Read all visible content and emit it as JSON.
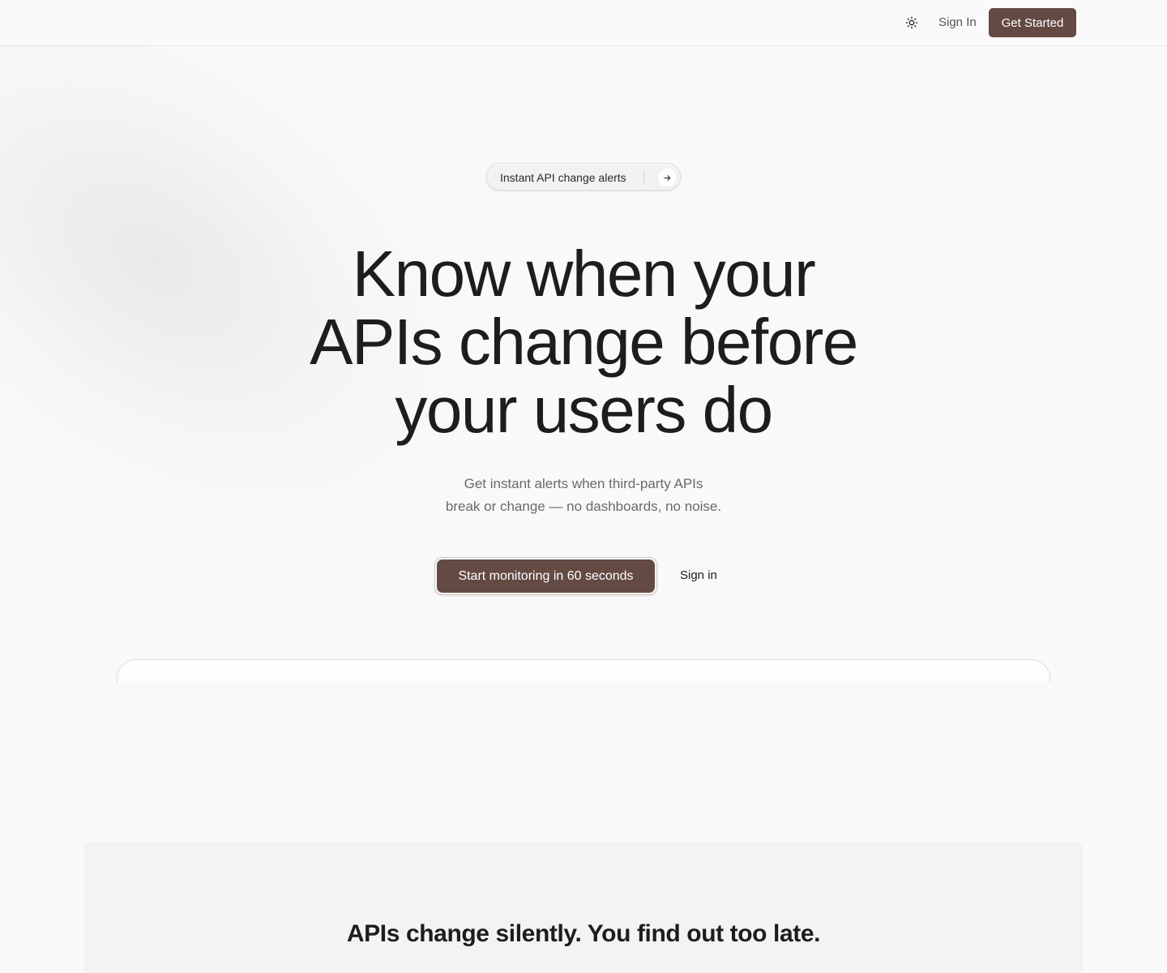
{
  "header": {
    "theme_icon": "sun-icon",
    "signin_label": "Sign In",
    "get_started_label": "Get Started"
  },
  "hero": {
    "pill_label": "Instant API change alerts",
    "pill_icon": "arrow-right-icon",
    "headline_line1": "Know when your",
    "headline_line2": "APIs change before",
    "headline_line3": "your users do",
    "subtext_line1": "Get instant alerts when third-party APIs",
    "subtext_line2": "break or change — no dashboards, no noise.",
    "cta_primary_label": "Start monitoring in 60 seconds",
    "cta_secondary_label": "Sign in"
  },
  "problem": {
    "title": "APIs change silently. You find out too late."
  },
  "colors": {
    "accent": "#634a43",
    "background": "#f9f9f9",
    "section_bg": "#f3f3f3",
    "text": "#1d1d1d",
    "muted_text": "#6a6a6a"
  }
}
